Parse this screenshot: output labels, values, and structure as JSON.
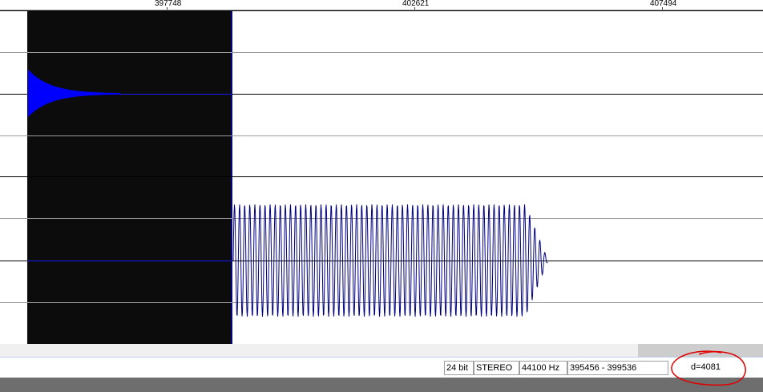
{
  "ruler": {
    "ticks": [
      "397748",
      "402621",
      "407494"
    ]
  },
  "status_bar": {
    "bit_depth": "24 bit",
    "channels": "STEREO",
    "sample_rate": "44100 Hz",
    "selection_range": "395456 - 399536",
    "selection_length": "d=4081"
  },
  "colors": {
    "selection_background": "#0c0c0c",
    "waveform_selected": "#0000ff",
    "waveform_unselected": "#000080",
    "annotation_circle": "#e00000"
  }
}
